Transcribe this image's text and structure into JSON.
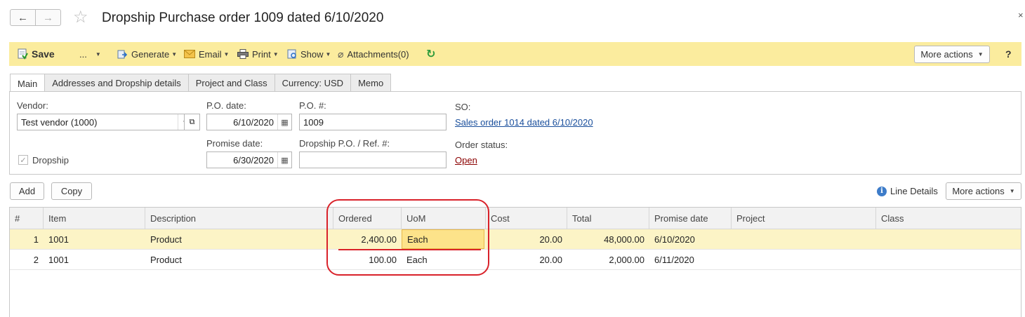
{
  "window": {
    "title": "Dropship Purchase order 1009 dated 6/10/2020",
    "back_icon": "←",
    "forward_icon": "→",
    "favorite_icon": "☆",
    "close_icon": "×"
  },
  "toolbar": {
    "save_label": "Save",
    "dots_label": "...",
    "generate_label": "Generate",
    "email_label": "Email",
    "print_label": "Print",
    "show_label": "Show",
    "attachments_label": "Attachments(0)",
    "more_actions_label": "More actions",
    "help_label": "?"
  },
  "tabs": [
    {
      "label": "Main",
      "active": true
    },
    {
      "label": "Addresses and Dropship details",
      "active": false
    },
    {
      "label": "Project and Class",
      "active": false
    },
    {
      "label": "Currency: USD",
      "active": false
    },
    {
      "label": "Memo",
      "active": false
    }
  ],
  "form": {
    "vendor_label": "Vendor:",
    "vendor_value": "Test vendor (1000)",
    "po_date_label": "P.O. date:",
    "po_date_value": "6/10/2020",
    "po_number_label": "P.O. #:",
    "po_number_value": "1009",
    "so_label": "SO:",
    "so_link": "Sales order 1014 dated 6/10/2020",
    "dropship_label": "Dropship",
    "dropship_checked": true,
    "promise_date_label": "Promise date:",
    "promise_date_value": "6/30/2020",
    "dropship_ref_label": "Dropship P.O. / Ref. #:",
    "dropship_ref_value": "",
    "order_status_label": "Order status:",
    "order_status_value": "Open"
  },
  "table_toolbar": {
    "add_label": "Add",
    "copy_label": "Copy",
    "line_details_label": "Line Details",
    "more_actions_label": "More actions"
  },
  "table": {
    "columns": [
      "#",
      "Item",
      "Description",
      "Ordered",
      "UoM",
      "Cost",
      "Total",
      "Promise date",
      "Project",
      "Class"
    ],
    "rows": [
      {
        "n": "1",
        "item": "1001",
        "description": "Product",
        "ordered": "2,400.00",
        "uom": "Each",
        "cost": "20.00",
        "total": "48,000.00",
        "promise_date": "6/10/2020",
        "project": "",
        "class": ""
      },
      {
        "n": "2",
        "item": "1001",
        "description": "Product",
        "ordered": "100.00",
        "uom": "Each",
        "cost": "20.00",
        "total": "2,000.00",
        "promise_date": "6/11/2020",
        "project": "",
        "class": ""
      }
    ]
  },
  "colors": {
    "toolbar_bg": "#fbec9e",
    "selected_row": "#fcf4c6",
    "focused_cell": "#fde38a",
    "link": "#1a4f9c",
    "status_link": "#8b0000",
    "annotation": "#d9222a"
  }
}
